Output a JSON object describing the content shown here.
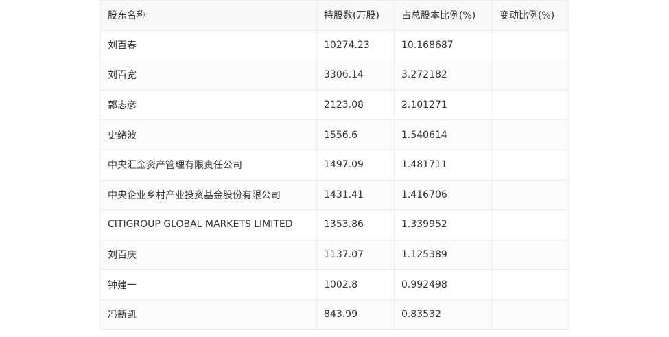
{
  "table": {
    "headers": [
      "股东名称",
      "持股数(万股)",
      "占总股本比例(%)",
      "变动比例(%)"
    ],
    "rows": [
      [
        "刘百春",
        "10274.23",
        "10.168687",
        ""
      ],
      [
        "刘百宽",
        "3306.14",
        "3.272182",
        ""
      ],
      [
        "郭志彦",
        "2123.08",
        "2.101271",
        ""
      ],
      [
        "史绪波",
        "1556.6",
        "1.540614",
        ""
      ],
      [
        "中央汇金资产管理有限责任公司",
        "1497.09",
        "1.481711",
        ""
      ],
      [
        "中央企业乡村产业投资基金股份有限公司",
        "1431.41",
        "1.416706",
        ""
      ],
      [
        "CITIGROUP GLOBAL MARKETS LIMITED",
        "1353.86",
        "1.339952",
        ""
      ],
      [
        "刘百庆",
        "1137.07",
        "1.125389",
        ""
      ],
      [
        "钟建一",
        "1002.8",
        "0.992498",
        ""
      ],
      [
        "冯新凯",
        "843.99",
        "0.83532",
        ""
      ]
    ]
  }
}
